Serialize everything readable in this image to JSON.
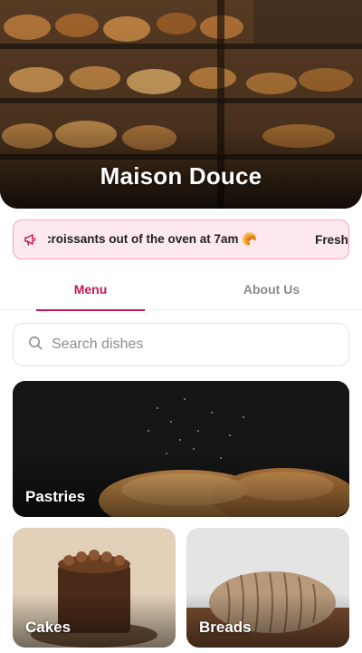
{
  "hero": {
    "title": "Maison Douce"
  },
  "announcement": {
    "icon": "megaphone-icon",
    "text": "croissants out of the oven at 7am 🥐",
    "next_text": "Fresh"
  },
  "tabs": [
    {
      "label": "Menu",
      "active": true
    },
    {
      "label": "About Us",
      "active": false
    }
  ],
  "search": {
    "placeholder": "Search dishes",
    "value": ""
  },
  "categories": [
    {
      "label": "Pastries"
    },
    {
      "label": "Cakes"
    },
    {
      "label": "Breads"
    }
  ],
  "colors": {
    "accent": "#c2185b",
    "announcement_bg": "#fde8ef",
    "announcement_border": "#f0a7c2"
  }
}
